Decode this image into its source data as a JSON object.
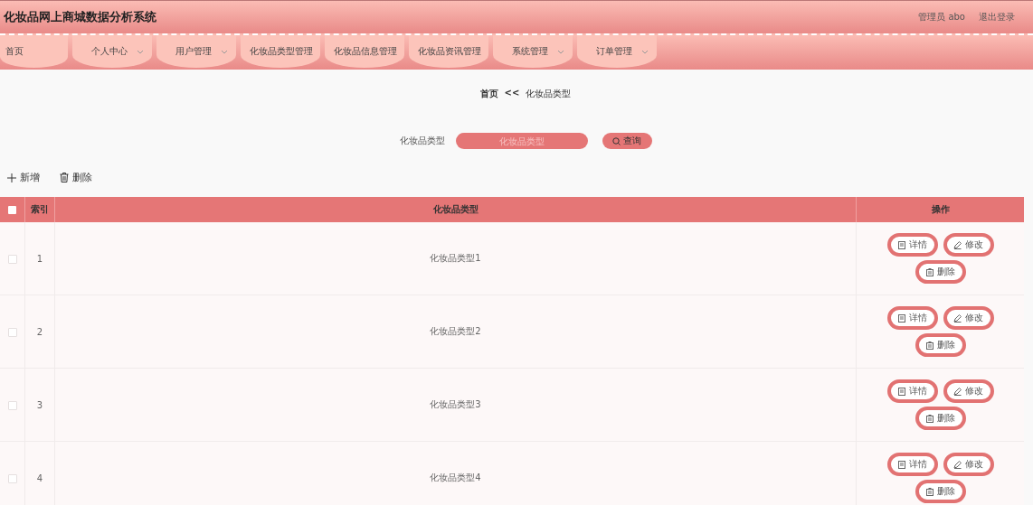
{
  "header": {
    "title": "化妆品网上商城数据分析系统",
    "user": "管理员 abo",
    "logout": "退出登录"
  },
  "nav": [
    {
      "label": "首页",
      "kind": "link"
    },
    {
      "label": "个人中心",
      "kind": "dropdown"
    },
    {
      "label": "用户管理",
      "kind": "dropdown"
    },
    {
      "label": "化妆品类型管理",
      "kind": "link"
    },
    {
      "label": "化妆品信息管理",
      "kind": "link"
    },
    {
      "label": "化妆品资讯管理",
      "kind": "link"
    },
    {
      "label": "系统管理",
      "kind": "dropdown"
    },
    {
      "label": "订单管理",
      "kind": "dropdown"
    }
  ],
  "breadcrumb": {
    "home": "首页",
    "separator": "<<",
    "current": "化妆品类型"
  },
  "search": {
    "label": "化妆品类型",
    "placeholder": "化妆品类型",
    "button": "查询"
  },
  "actions": {
    "add": "新增",
    "delete": "删除"
  },
  "table": {
    "select_all_checked": false,
    "columns": [
      "索引",
      "化妆品类型",
      "操作"
    ],
    "rows": [
      {
        "checked": false,
        "index": "1",
        "type": "化妆品类型1",
        "actions": {
          "detail": "详情",
          "edit": "修改",
          "delete": "删除"
        }
      },
      {
        "checked": false,
        "index": "2",
        "type": "化妆品类型2",
        "actions": {
          "detail": "详情",
          "edit": "修改",
          "delete": "删除"
        }
      },
      {
        "checked": false,
        "index": "3",
        "type": "化妆品类型3",
        "actions": {
          "detail": "详情",
          "edit": "修改",
          "delete": "删除"
        }
      },
      {
        "checked": false,
        "index": "4",
        "type": "化妆品类型4",
        "actions": {
          "detail": "详情",
          "edit": "修改",
          "delete": "删除"
        }
      }
    ]
  }
}
